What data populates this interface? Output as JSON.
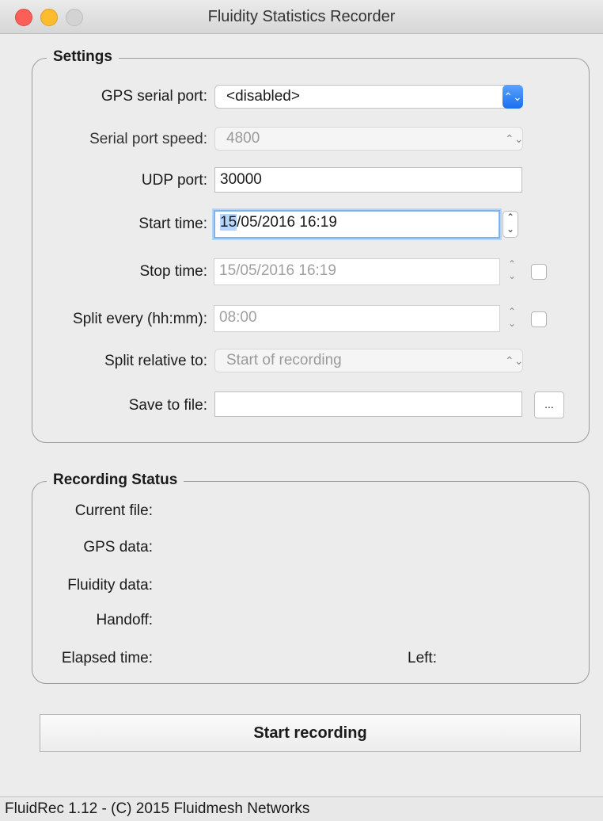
{
  "window": {
    "title": "Fluidity Statistics Recorder"
  },
  "settings": {
    "title": "Settings",
    "gps_serial_port": {
      "label": "GPS serial port:",
      "value": "<disabled>"
    },
    "serial_port_speed": {
      "label": "Serial port speed:",
      "value": "4800"
    },
    "udp_port": {
      "label": "UDP port:",
      "value": "30000"
    },
    "start_time": {
      "label": "Start time:",
      "value_selected": "15",
      "value_rest": "/05/2016 16:19"
    },
    "stop_time": {
      "label": "Stop time:",
      "value": "15/05/2016 16:19"
    },
    "split_every": {
      "label": "Split every (hh:mm):",
      "value": "08:00"
    },
    "split_relative": {
      "label": "Split relative  to:",
      "value": "Start of recording"
    },
    "save_to_file": {
      "label": "Save to file:",
      "value": "",
      "browse_label": "..."
    }
  },
  "status": {
    "title": "Recording Status",
    "current_file_label": "Current file:",
    "gps_data_label": "GPS data:",
    "fluidity_data_label": "Fluidity data:",
    "handoff_label": "Handoff:",
    "elapsed_time_label": "Elapsed time:",
    "left_label": "Left:"
  },
  "actions": {
    "start_recording": "Start recording"
  },
  "footer": {
    "text": "FluidRec 1.12 - (C) 2015 Fluidmesh Networks"
  },
  "icons": {
    "combo_arrows": "⌃⌄"
  },
  "colors": {
    "accent": "#1a6ef0",
    "close": "#fc5f57",
    "minimize": "#fdbc2e"
  }
}
